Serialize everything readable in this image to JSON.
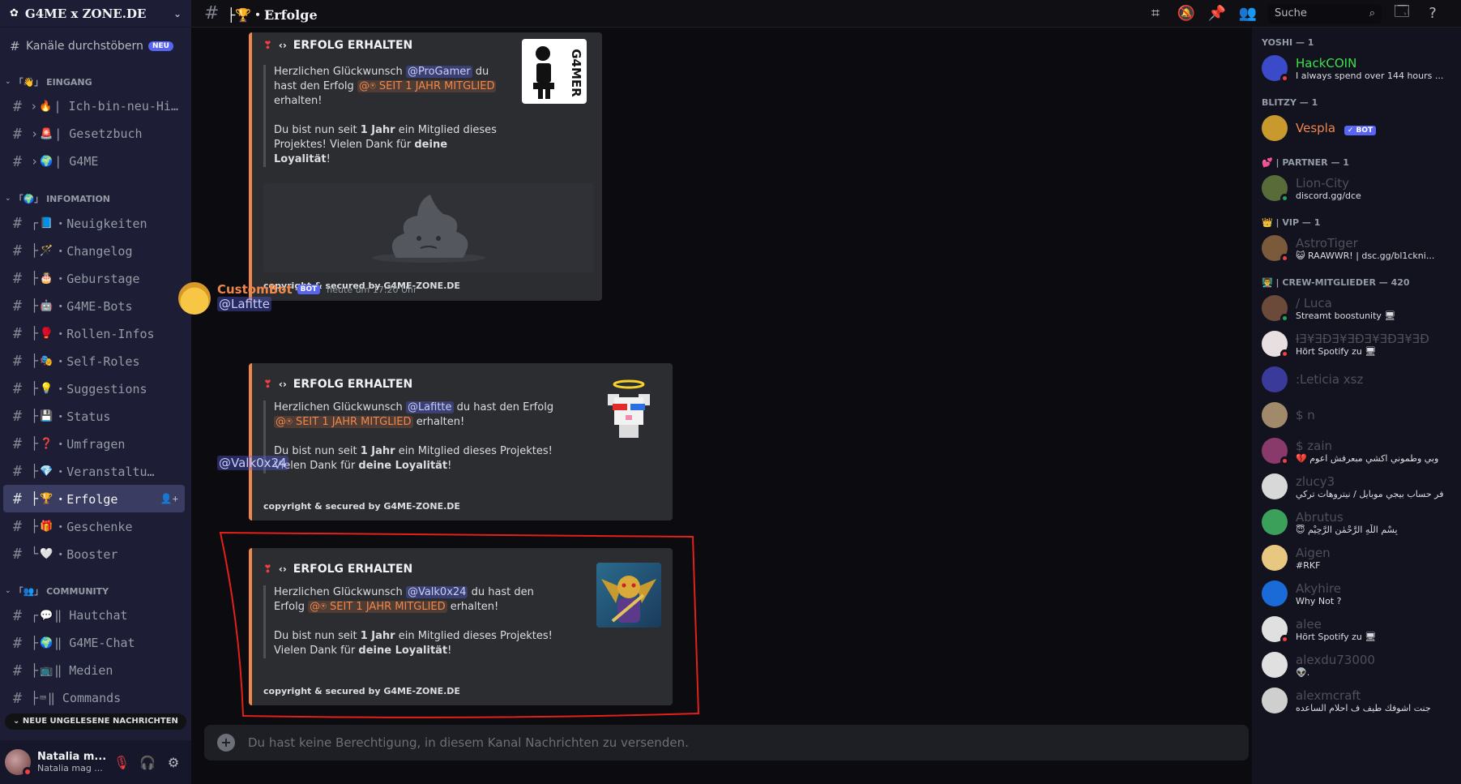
{
  "server": {
    "name": "G4ME x ZONE.DE",
    "browse_label": "Kanäle durchstöbern",
    "browse_badge": "NEU"
  },
  "sidebar": {
    "categories": [
      {
        "label": "「👋」 EINGANG",
        "channels": [
          {
            "prefix": "›",
            "emoji": "🔥",
            "label": "| Ich-bin-neu-Hi…"
          },
          {
            "prefix": "›",
            "emoji": "🚨",
            "label": "| Gesetzbuch"
          },
          {
            "prefix": "›",
            "emoji": "🌍",
            "label": "| G4ME"
          }
        ]
      },
      {
        "label": "「🌍」 INFOMATION",
        "channels": [
          {
            "prefix": "┌",
            "emoji": "📘",
            "label": "・Neuigkeiten"
          },
          {
            "prefix": "├",
            "emoji": "🪄",
            "label": "・Changelog"
          },
          {
            "prefix": "├",
            "emoji": "🎂",
            "label": "・Geburstage"
          },
          {
            "prefix": "├",
            "emoji": "🤖",
            "label": "・G4ME-Bots"
          },
          {
            "prefix": "├",
            "emoji": "🥊",
            "label": "・Rollen-Infos"
          },
          {
            "prefix": "├",
            "emoji": "🎭",
            "label": "・Self-Roles"
          },
          {
            "prefix": "├",
            "emoji": "💡",
            "label": "・Suggestions"
          },
          {
            "prefix": "├",
            "emoji": "💾",
            "label": "・Status"
          },
          {
            "prefix": "├",
            "emoji": "❓",
            "label": "・Umfragen"
          },
          {
            "prefix": "├",
            "emoji": "💎",
            "label": "・Veranstaltu…"
          },
          {
            "prefix": "├",
            "emoji": "🏆",
            "label": "・Erfolge",
            "active": true
          },
          {
            "prefix": "├",
            "emoji": "🎁",
            "label": "・Geschenke"
          },
          {
            "prefix": "└",
            "emoji": "🤍",
            "label": "・Booster"
          }
        ]
      },
      {
        "label": "「👥」 COMMUNITY",
        "channels": [
          {
            "prefix": "┌",
            "emoji": "💬",
            "label": "‖ Hautchat"
          },
          {
            "prefix": "├",
            "emoji": "🌍",
            "label": "‖ G4ME-Chat"
          },
          {
            "prefix": "├",
            "emoji": "📺",
            "label": "‖ Medien"
          },
          {
            "prefix": "├",
            "emoji": "⌨",
            "label": "‖ Commands"
          }
        ]
      }
    ],
    "unread_label": "NEUE UNGELESENE NACHRICHTEN"
  },
  "user": {
    "name": "Natalia m...",
    "status": "Natalia mag ..."
  },
  "topbar": {
    "channel": "├🏆・Erfolge",
    "search_placeholder": "Suche"
  },
  "messages": {
    "embed_title": "ERFOLG ERHALTEN",
    "footer": "copyright & secured by G4ME-ZONE.DE",
    "congrats": "Herzlichen Glückwunsch",
    "verb_have": "du hast den Erfolg",
    "achievement_prefix": "@⍟",
    "achievement": "SEIT 1 JAHR MITGLIED",
    "received": "erhalten!",
    "body_a": "Du bist nun seit",
    "body_bold1": "1 Jahr",
    "body_b": "ein Mitglied dieses Projektes! Vielen Dank für",
    "body_bold2": "deine Loyalität",
    "body_end": "!",
    "first": {
      "mention": "@ProGamer",
      "thumb_label": "G4MER"
    },
    "bot": {
      "name": "CustomBot",
      "tag": "BOT",
      "time": "heute um 17:20 Uhr"
    },
    "second": {
      "mention": "@Lafitte"
    },
    "third": {
      "mention": "@Valk0x24"
    }
  },
  "composer": {
    "placeholder": "Du hast keine Berechtigung, in diesem Kanal Nachrichten zu versenden."
  },
  "members": {
    "groups": [
      {
        "label": "YOSHI — 1",
        "items": [
          {
            "name": "HackCOIN",
            "sub": "I always spend over 144 hours ...",
            "color": "#3be14b"
          }
        ]
      },
      {
        "label": "BLITZY — 1",
        "items": [
          {
            "name": "Vespla",
            "sub": "",
            "color": "#f0874a",
            "badge": "✓ BOT"
          }
        ]
      },
      {
        "label": "💕 | PARTNER — 1",
        "items": [
          {
            "name": "Lion-City",
            "sub": "discord.gg/dce"
          }
        ]
      },
      {
        "label": "👑 | VIP — 1",
        "items": [
          {
            "name": "AstroTiger",
            "sub": "😺 RAAWWR! | dsc.gg/bl1ckni..."
          }
        ]
      },
      {
        "label": "👨‍🏫 | CREW-MITGLIEDER — 420",
        "items": [
          {
            "name": "/ Luca",
            "sub": "Streamt boostunity 🖥"
          },
          {
            "name": "ƗƎ¥ƎĐƎ¥ƎĐƎ¥ƎĐƎ¥ƎĐ",
            "sub": "Hört Spotify zu 🖥"
          },
          {
            "name": ":Leticia xsz",
            "sub": ""
          },
          {
            "name": "$ n",
            "sub": ""
          },
          {
            "name": "$ zain",
            "sub": "💔 وبي وطموني اكشي مبعرفش اعوم"
          },
          {
            "name": "zlucy3",
            "sub": "فر حساب بيجي موبايل / نيتروهات تركي"
          },
          {
            "name": "Abrutus",
            "sub": "😇 بِسْمِ اللّٰهِ الرَّحْمٰنِ الرَّحِيْمِ"
          },
          {
            "name": "Aigen",
            "sub": "#RKF"
          },
          {
            "name": "Akyhire",
            "sub": "Why Not ?"
          },
          {
            "name": "alee",
            "sub": "Hört Spotify zu 🖥"
          },
          {
            "name": "alexdu73000",
            "sub": "👽."
          },
          {
            "name": "alexmcraft",
            "sub": "جنت اشوفك طيف ف احلام الساعده"
          }
        ]
      }
    ]
  }
}
